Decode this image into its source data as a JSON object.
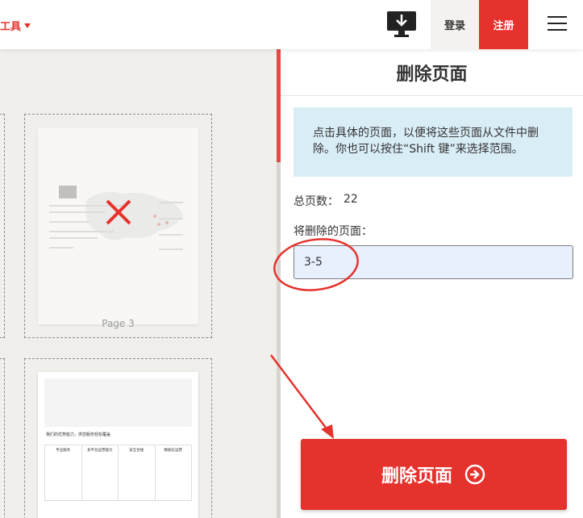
{
  "header": {
    "tools_label": "工具",
    "download_icon": "desktop-download-icon",
    "login_label": "登录",
    "signup_label": "注册",
    "menu_icon": "hamburger-menu-icon",
    "accent_color": "#e5322d"
  },
  "workspace": {
    "pages": [
      {
        "label": "Page 3",
        "marked_for_delete": true
      },
      {
        "label": "",
        "marked_for_delete": false
      }
    ],
    "page4_heading": "我们的优势能力，供您服务轻松覆盖",
    "page4_columns": [
      "专业服务",
      "多平台运营能力",
      "安全合规",
      "数据化运营"
    ]
  },
  "panel": {
    "title": "删除页面",
    "info_text": "点击具体的页面，以便将这些页面从文件中删除。你也可以按住“Shift 键”来选择范围。",
    "total_pages_label": "总页数：",
    "total_pages_value": "22",
    "pages_to_delete_label": "将删除的页面：",
    "pages_to_delete_value": "3-5",
    "delete_button_label": "删除页面",
    "delete_button_icon": "arrow-circle-right-icon",
    "info_bg_color": "#d9edf7",
    "input_bg_color": "#e8f0fe"
  }
}
